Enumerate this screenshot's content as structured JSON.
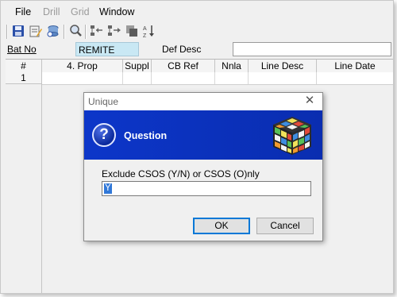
{
  "menu": [
    {
      "label": "File",
      "disabled": false
    },
    {
      "label": "Drill",
      "disabled": true
    },
    {
      "label": "Grid",
      "disabled": true
    },
    {
      "label": "Window",
      "disabled": false
    }
  ],
  "toolbar": {
    "icons": [
      "save-icon",
      "edit-icon",
      "database-refresh-icon",
      "search-icon",
      "tree-collapse-icon",
      "tree-expand-icon",
      "copy-icon",
      "sort-az-icon"
    ]
  },
  "batch": {
    "label": "Bat No",
    "value": "REMITE",
    "def_desc_label": "Def Desc",
    "def_desc_value": ""
  },
  "grid": {
    "columns": [
      "#",
      "4.  Prop",
      "Suppl",
      "CB Ref",
      "Nnla",
      "Line Desc",
      "Line Date"
    ],
    "rows": [
      {
        "num": "1",
        "cells": [
          "",
          "",
          "",
          "",
          "",
          ""
        ]
      }
    ]
  },
  "dialog": {
    "title": "Unique",
    "close_glyph": "✕",
    "heading": "Question",
    "question_glyph": "?",
    "prompt": "Exclude CSOS (Y/N) or CSOS (O)nly",
    "answer": "Y",
    "ok_label": "OK",
    "cancel_label": "Cancel",
    "banner_color": "#0c36c9"
  }
}
